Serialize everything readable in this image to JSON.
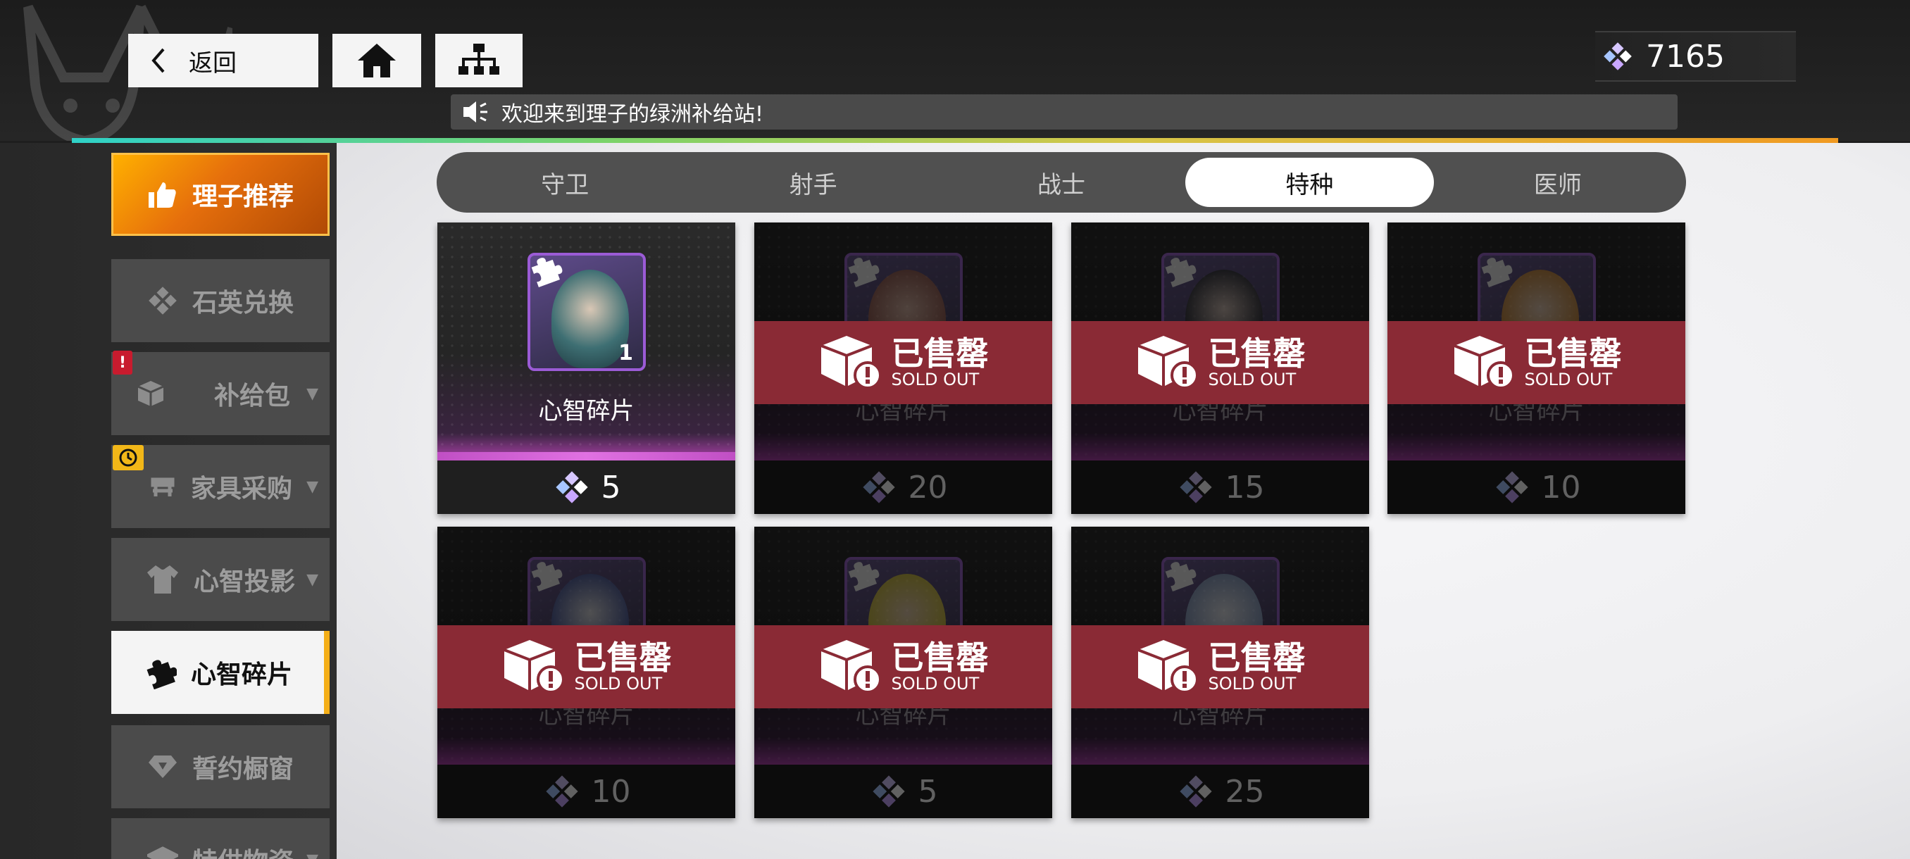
{
  "header": {
    "back_label": "返回",
    "currency_amount": "7165",
    "notice_text": "欢迎来到理子的绿洲补给站!"
  },
  "sidebar": {
    "items": [
      {
        "label": "理子推荐",
        "icon": "thumbs-up-icon"
      },
      {
        "label": "石英兑换",
        "icon": "quartz-icon"
      },
      {
        "label": "补给包",
        "icon": "box-icon"
      },
      {
        "label": "家具采购",
        "icon": "furniture-icon"
      },
      {
        "label": "心智投影",
        "icon": "shirt-icon"
      },
      {
        "label": "心智碎片",
        "icon": "puzzle-icon"
      },
      {
        "label": "誓约橱窗",
        "icon": "diamond-icon"
      },
      {
        "label": "特供物资",
        "icon": "special-icon"
      }
    ],
    "badge_alert": "!"
  },
  "tabs": [
    "守卫",
    "射手",
    "战士",
    "特种",
    "医师"
  ],
  "active_tab": "特种",
  "sold_out": {
    "cn": "已售罄",
    "en": "SOLD OUT"
  },
  "items": [
    {
      "name": "心智碎片",
      "count": "1",
      "price": "5",
      "sold": false
    },
    {
      "name": "心智碎片",
      "count": "",
      "price": "20",
      "sold": true
    },
    {
      "name": "心智碎片",
      "count": "",
      "price": "15",
      "sold": true
    },
    {
      "name": "心智碎片",
      "count": "",
      "price": "10",
      "sold": true
    },
    {
      "name": "心智碎片",
      "count": "",
      "price": "10",
      "sold": true
    },
    {
      "name": "心智碎片",
      "count": "",
      "price": "5",
      "sold": true
    },
    {
      "name": "心智碎片",
      "count": "",
      "price": "25",
      "sold": true
    }
  ],
  "colors": {
    "featured": "#e66f0c",
    "sold_banner": "#8a2a35",
    "accent": "#f4ae17",
    "frame": "#9b5bd6"
  }
}
